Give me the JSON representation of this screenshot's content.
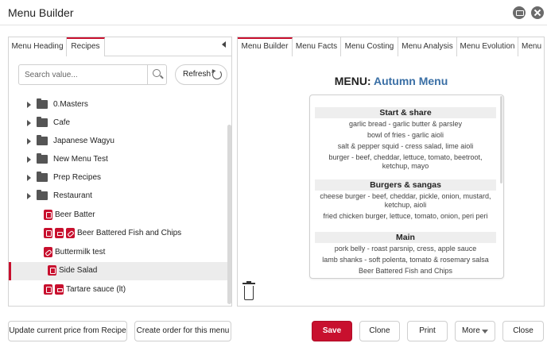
{
  "window": {
    "title": "Menu Builder"
  },
  "left_tabs": [
    {
      "label": "Menu Heading"
    },
    {
      "label": "Recipes"
    }
  ],
  "search": {
    "placeholder": "Search value...",
    "value": ""
  },
  "refresh_label": "Refresh",
  "tree": [
    {
      "label": "0.Masters",
      "type": "folder"
    },
    {
      "label": "Cafe",
      "type": "folder"
    },
    {
      "label": "Japanese Wagyu",
      "type": "folder"
    },
    {
      "label": "New Menu Test",
      "type": "folder"
    },
    {
      "label": "Prep Recipes",
      "type": "folder"
    },
    {
      "label": "Restaurant",
      "type": "folder"
    },
    {
      "label": "Beer Batter",
      "type": "recipe",
      "icons": [
        "recipe-icon"
      ]
    },
    {
      "label": "Beer Battered Fish and Chips",
      "type": "recipe",
      "icons": [
        "recipe-icon",
        "sub-recipe-icon",
        "link-icon"
      ]
    },
    {
      "label": "Buttermilk test",
      "type": "recipe",
      "icons": [
        "link-icon"
      ]
    },
    {
      "label": "Side Salad",
      "type": "recipe",
      "icons": [
        "recipe-icon"
      ],
      "selected": true
    },
    {
      "label": "Tartare sauce (lt)",
      "type": "recipe",
      "icons": [
        "recipe-icon",
        "sub-recipe-icon"
      ]
    }
  ],
  "right_tabs": [
    {
      "label": "Menu Builder"
    },
    {
      "label": "Menu Facts"
    },
    {
      "label": "Menu Costing"
    },
    {
      "label": "Menu Analysis"
    },
    {
      "label": "Menu Evolution"
    },
    {
      "label": "Menu"
    }
  ],
  "menu": {
    "prefix": "MENU:",
    "name": "Autumn Menu",
    "sections": [
      {
        "heading": "Start & share",
        "items": [
          "garlic bread - garlic butter & parsley",
          "bowl of fries - garlic aioli",
          "salt & pepper squid - cress salad, lime aioli",
          "burger - beef, cheddar, lettuce, tomato, beetroot, ketchup, mayo"
        ]
      },
      {
        "heading": "Burgers & sangas",
        "items": [
          "cheese burger - beef, cheddar, pickle, onion, mustard, ketchup, aioli",
          "fried chicken burger, lettuce, tomato, onion, peri peri"
        ]
      },
      {
        "heading": "Main",
        "items": [
          "pork belly - roast parsnip, cress, apple sauce",
          "lamb shanks - soft polenta, tomato & rosemary salsa",
          "Beer Battered Fish and Chips"
        ]
      }
    ]
  },
  "footer": {
    "update_price": "Update current price from Recipe",
    "create_order": "Create order for this menu",
    "save": "Save",
    "clone": "Clone",
    "print": "Print",
    "more": "More",
    "close": "Close"
  },
  "colors": {
    "accent": "#c8102e",
    "menu_name": "#3a6fa5"
  }
}
